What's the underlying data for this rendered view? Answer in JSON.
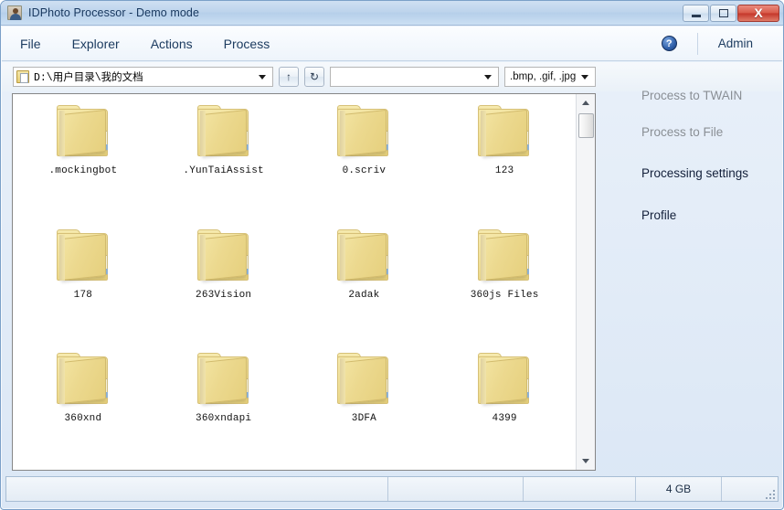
{
  "window": {
    "title": "IDPhoto Processor - Demo mode",
    "app_icon": "portrait-photo-icon",
    "minimize_label": "Minimize",
    "maximize_label": "Maximize",
    "close_label": "X"
  },
  "menubar": {
    "items": [
      {
        "label": "File",
        "name": "menu-file"
      },
      {
        "label": "Explorer",
        "name": "menu-explorer"
      },
      {
        "label": "Actions",
        "name": "menu-actions"
      },
      {
        "label": "Process",
        "name": "menu-process"
      }
    ],
    "help_icon": "?",
    "admin_label": "Admin"
  },
  "toolbar": {
    "path_value": "D:\\用户目录\\我的文档",
    "path_icon": "folder-document-icon",
    "up_button": "↑",
    "refresh_button": "↻",
    "blank_combo_value": "",
    "blank_combo_placeholder": "",
    "filter_value": ".bmp, .gif, .jpg"
  },
  "files": {
    "items": [
      {
        "label": ".mockingbot",
        "type": "folder"
      },
      {
        "label": ".YunTaiAssist",
        "type": "folder"
      },
      {
        "label": "0.scriv",
        "type": "folder"
      },
      {
        "label": "123",
        "type": "folder"
      },
      {
        "label": "178",
        "type": "folder"
      },
      {
        "label": "263Vision",
        "type": "folder"
      },
      {
        "label": "2adak",
        "type": "folder"
      },
      {
        "label": "360js Files",
        "type": "folder"
      },
      {
        "label": "360xnd",
        "type": "folder"
      },
      {
        "label": "360xndapi",
        "type": "folder"
      },
      {
        "label": "3DFA",
        "type": "folder"
      },
      {
        "label": "4399",
        "type": "folder"
      }
    ]
  },
  "sidepanel": {
    "links": [
      {
        "label": "Process to TWAIN",
        "state": "disabled"
      },
      {
        "label": "Process to File",
        "state": "disabled"
      },
      {
        "label": "Processing settings",
        "state": "active"
      },
      {
        "label": "Profile",
        "state": "active"
      }
    ]
  },
  "statusbar": {
    "cell1": "",
    "cell2": "",
    "cell3": "",
    "cell4": "4 GB",
    "cell5": ""
  },
  "colors": {
    "titlebar_blue": "#bdd4ec",
    "close_red": "#c4362a",
    "folder_yellow": "#eedc91",
    "accent_text": "#17375e",
    "disabled_text": "#8a8f95"
  }
}
